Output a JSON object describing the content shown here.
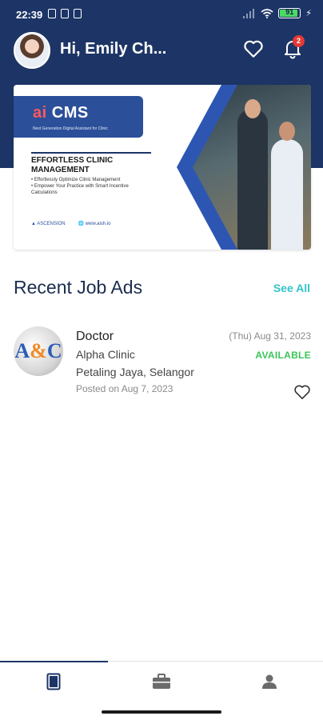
{
  "status_bar": {
    "time": "22:39",
    "battery": "91"
  },
  "header": {
    "greeting": "Hi, Emily Ch...",
    "notification_count": "2"
  },
  "banner": {
    "logo": "CMS",
    "tagline": "Next Generation Digital Assistant for Clinic",
    "title": "EFFORTLESS CLINIC MANAGEMENT",
    "bullets": [
      "• Effortlessly Optimize Clinic Management",
      "• Empower Your Practice with Smart Incentive Calculations"
    ],
    "footer_brand": "ASCENSION",
    "footer_url": "www.aish.io",
    "active_slide": 1,
    "slide_count": 3
  },
  "recent_jobs": {
    "title": "Recent Job Ads",
    "see_all": "See All",
    "items": [
      {
        "title": "Doctor",
        "company": "Alpha Clinic",
        "location": "Petaling Jaya, Selangor",
        "posted": "Posted on Aug 7, 2023",
        "date": "(Thu) Aug 31, 2023",
        "status": "AVAILABLE"
      }
    ]
  },
  "bottom_nav": {
    "tabs": [
      {
        "icon": "book-icon",
        "active": true
      },
      {
        "icon": "briefcase-icon",
        "active": false
      },
      {
        "icon": "profile-icon",
        "active": false
      }
    ]
  },
  "colors": {
    "primary": "#1d3566",
    "accent": "#33c3c7",
    "available": "#3cc35a",
    "badge": "#e53935"
  }
}
